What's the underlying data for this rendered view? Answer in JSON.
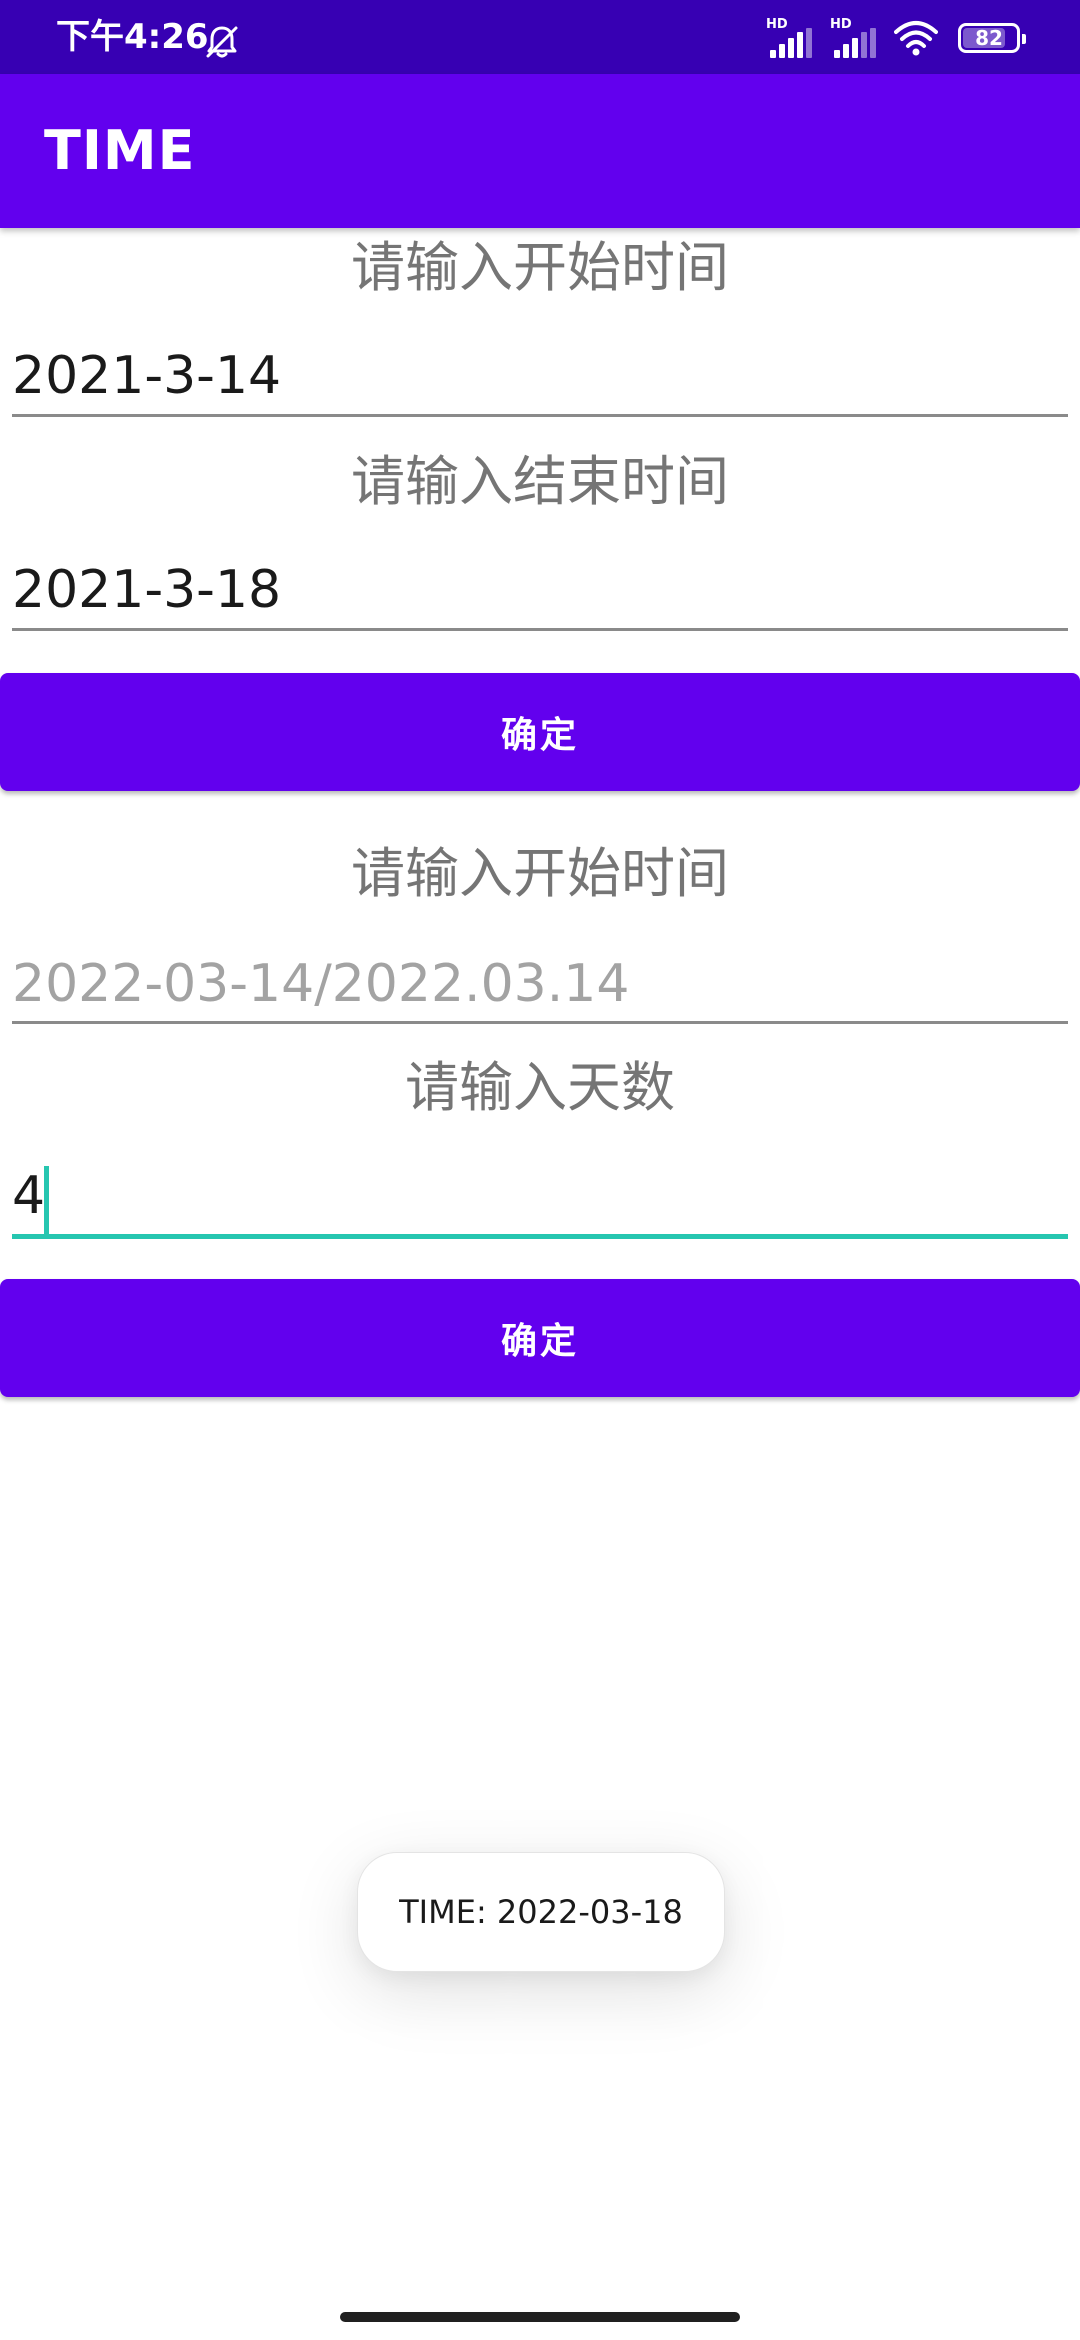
{
  "status_bar": {
    "time": "下午4:26",
    "sim1_label": "HD",
    "sim2_label": "HD",
    "battery_percent": "82",
    "icons": [
      "bell-off-icon",
      "signal-icon",
      "wifi-icon",
      "battery-icon"
    ]
  },
  "app_bar": {
    "title": "TIME"
  },
  "section1": {
    "start_label": "请输入开始时间",
    "start_value": "2021-3-14",
    "end_label": "请输入结束时间",
    "end_value": "2021-3-18",
    "confirm_label": "确定"
  },
  "section2": {
    "start_label": "请输入开始时间",
    "start_placeholder": "2022-03-14/2022.03.14",
    "days_label": "请输入天数",
    "days_value": "4",
    "confirm_label": "确定"
  },
  "toast": {
    "message": "TIME: 2022-03-18"
  },
  "colors": {
    "status_bar": "#3700B3",
    "primary": "#6200EE",
    "focus_accent": "#26C6B0",
    "hint_text": "#757575"
  }
}
